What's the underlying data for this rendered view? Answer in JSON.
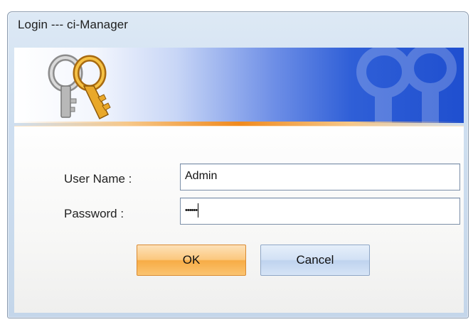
{
  "window": {
    "title": "Login --- ci-Manager"
  },
  "banner": {
    "logo_icon": "keys-icon",
    "watermark_icon": "keys-watermark-icon",
    "accent_color": "#1f4fcf",
    "stripe_color": "#f08a1e"
  },
  "form": {
    "username_label": "User Name :",
    "username_value": "Admin",
    "password_label": "Password :",
    "password_value": "••••••"
  },
  "buttons": {
    "ok_label": "OK",
    "cancel_label": "Cancel"
  }
}
